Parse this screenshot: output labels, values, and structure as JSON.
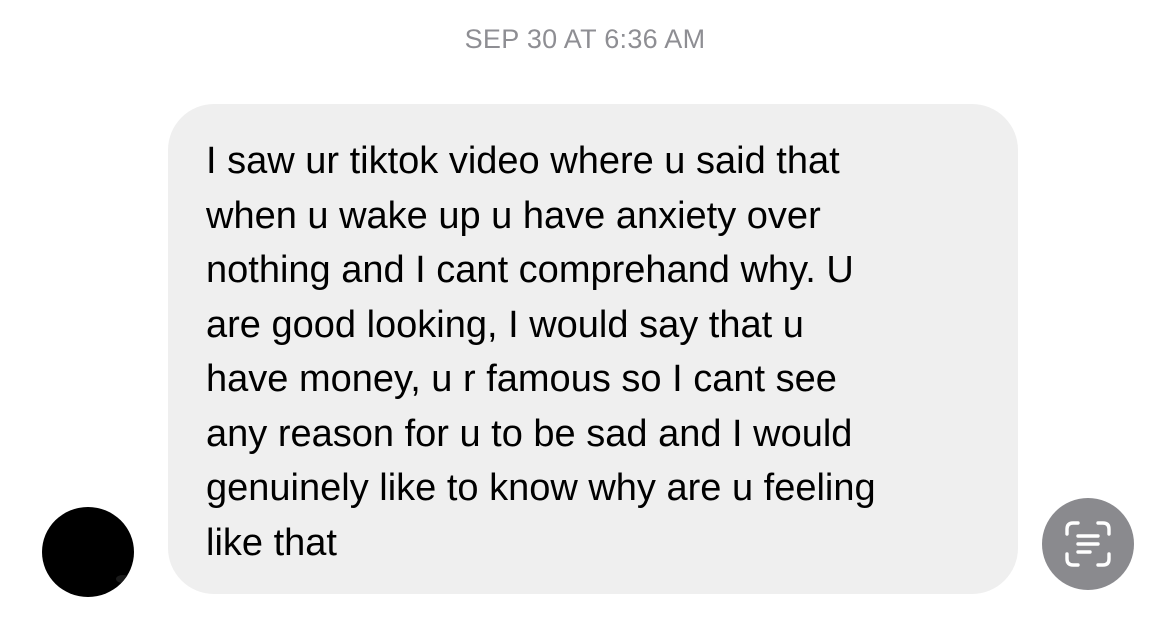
{
  "conversation": {
    "timestamp": "SEP 30 AT 6:36 AM",
    "message": {
      "text": "I saw ur tiktok video where u said that\nwhen u wake up u have anxiety over\nnothing and I cant comprehand why. U\nare good looking, I would say that u\nhave money, u r famous so I cant see\nany reason for u to be sad and I would\ngenuinely like to know why are u feeling\nlike that"
    },
    "sender_avatar": {
      "color": "#000000"
    },
    "live_text_button": {
      "icon": "live-text-scan-icon",
      "color": "#8a8a8e"
    }
  },
  "colors": {
    "bubble_background": "#efefef",
    "timestamp_text": "#8e8e93",
    "message_text": "#000000"
  }
}
